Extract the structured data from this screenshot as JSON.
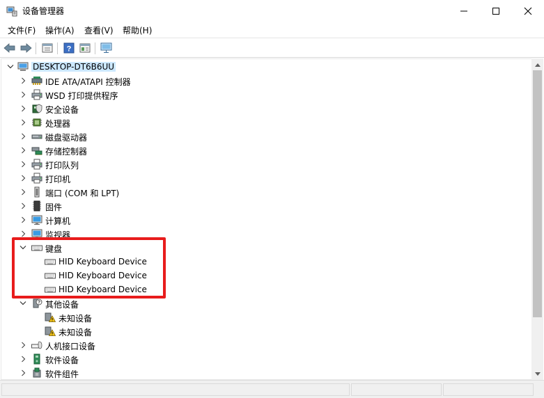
{
  "window": {
    "title": "设备管理器",
    "minimize_glyph": "—",
    "maximize_glyph": "☐",
    "close_glyph": "✕"
  },
  "menu": {
    "items": [
      {
        "label": "文件(F)"
      },
      {
        "label": "操作(A)"
      },
      {
        "label": "查看(V)"
      },
      {
        "label": "帮助(H)"
      }
    ]
  },
  "toolbar": {
    "buttons": [
      "back-arrow-icon",
      "forward-arrow-icon",
      "properties-icon",
      "help-icon",
      "action-view-icon",
      "monitor-scan-icon"
    ]
  },
  "tree": {
    "root": {
      "label": "DESKTOP-DT6B6UU",
      "icon": "computer-icon",
      "expanded": true
    },
    "rows": [
      {
        "label": "IDE ATA/ATAPI 控制器",
        "icon": "ide-controller-icon",
        "level": 1,
        "state": "collapsed"
      },
      {
        "label": "WSD 打印提供程序",
        "icon": "printer-icon",
        "level": 1,
        "state": "collapsed"
      },
      {
        "label": "安全设备",
        "icon": "security-device-icon",
        "level": 1,
        "state": "collapsed"
      },
      {
        "label": "处理器",
        "icon": "processor-icon",
        "level": 1,
        "state": "collapsed"
      },
      {
        "label": "磁盘驱动器",
        "icon": "disk-drive-icon",
        "level": 1,
        "state": "collapsed"
      },
      {
        "label": "存储控制器",
        "icon": "storage-controller-icon",
        "level": 1,
        "state": "collapsed"
      },
      {
        "label": "打印队列",
        "icon": "printer-icon",
        "level": 1,
        "state": "collapsed"
      },
      {
        "label": "打印机",
        "icon": "printer-icon",
        "level": 1,
        "state": "collapsed"
      },
      {
        "label": "端口 (COM 和 LPT)",
        "icon": "port-icon",
        "level": 1,
        "state": "collapsed"
      },
      {
        "label": "固件",
        "icon": "firmware-icon",
        "level": 1,
        "state": "collapsed"
      },
      {
        "label": "计算机",
        "icon": "monitor-icon",
        "level": 1,
        "state": "collapsed"
      },
      {
        "label": "监视器",
        "icon": "monitor-icon",
        "level": 1,
        "state": "collapsed"
      },
      {
        "label": "键盘",
        "icon": "keyboard-icon",
        "level": 1,
        "state": "expanded"
      },
      {
        "label": "HID Keyboard Device",
        "icon": "keyboard-icon",
        "level": 2,
        "state": "leaf"
      },
      {
        "label": "HID Keyboard Device",
        "icon": "keyboard-icon",
        "level": 2,
        "state": "leaf"
      },
      {
        "label": "HID Keyboard Device",
        "icon": "keyboard-icon",
        "level": 2,
        "state": "leaf"
      },
      {
        "label": "其他设备",
        "icon": "unknown-device-icon",
        "level": 1,
        "state": "expanded"
      },
      {
        "label": "未知设备",
        "icon": "warning-device-icon",
        "level": 2,
        "state": "leaf"
      },
      {
        "label": "未知设备",
        "icon": "warning-device-icon",
        "level": 2,
        "state": "leaf"
      },
      {
        "label": "人机接口设备",
        "icon": "hid-icon",
        "level": 1,
        "state": "collapsed"
      },
      {
        "label": "软件设备",
        "icon": "software-device-icon",
        "level": 1,
        "state": "collapsed"
      },
      {
        "label": "软件组件",
        "icon": "software-component-icon",
        "level": 1,
        "state": "collapsed"
      }
    ]
  },
  "scrollbar": {
    "position_fraction": 0.0,
    "visible_fraction": 0.83
  },
  "colors": {
    "selection": "#cce8ff",
    "highlight": "#e81c1c",
    "accent": "#0078d7"
  }
}
